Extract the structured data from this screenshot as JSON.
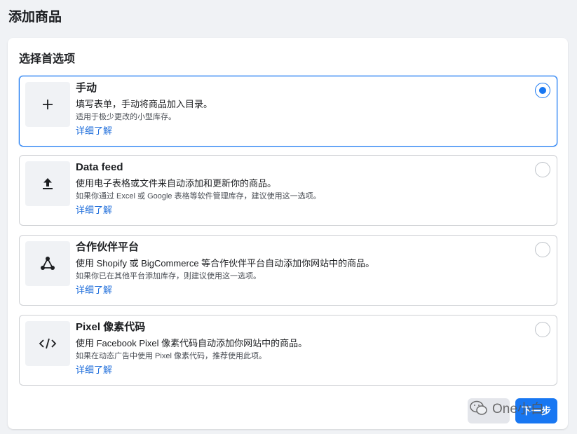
{
  "page": {
    "title": "添加商品"
  },
  "card": {
    "title": "选择首选项"
  },
  "options": [
    {
      "icon": "plus-icon",
      "title": "手动",
      "description": "填写表单，手动将商品加入目录。",
      "subtext": "适用于极少更改的小型库存。",
      "link": "详细了解",
      "selected": true
    },
    {
      "icon": "upload-icon",
      "title": "Data feed",
      "description": "使用电子表格或文件来自动添加和更新你的商品。",
      "subtext": "如果你通过 Excel 或 Google 表格等软件管理库存，建议使用这一选项。",
      "link": "详细了解",
      "selected": false
    },
    {
      "icon": "partner-network-icon",
      "title": "合作伙伴平台",
      "description": "使用 Shopify 或 BigCommerce 等合作伙伴平台自动添加你网站中的商品。",
      "subtext": "如果你已在其他平台添加库存，则建议使用这一选项。",
      "link": "详细了解",
      "selected": false
    },
    {
      "icon": "code-icon",
      "title": "Pixel 像素代码",
      "description": "使用 Facebook Pixel 像素代码自动添加你网站中的商品。",
      "subtext": "如果在动态广告中使用 Pixel 像素代码，推荐使用此项。",
      "link": "详细了解",
      "selected": false
    }
  ],
  "footer": {
    "cancel_label": "",
    "next_label": "下一步"
  },
  "watermark": {
    "text": "One小白"
  },
  "colors": {
    "accent": "#1877f2",
    "link": "#216fdb",
    "background": "#f0f2f5"
  }
}
